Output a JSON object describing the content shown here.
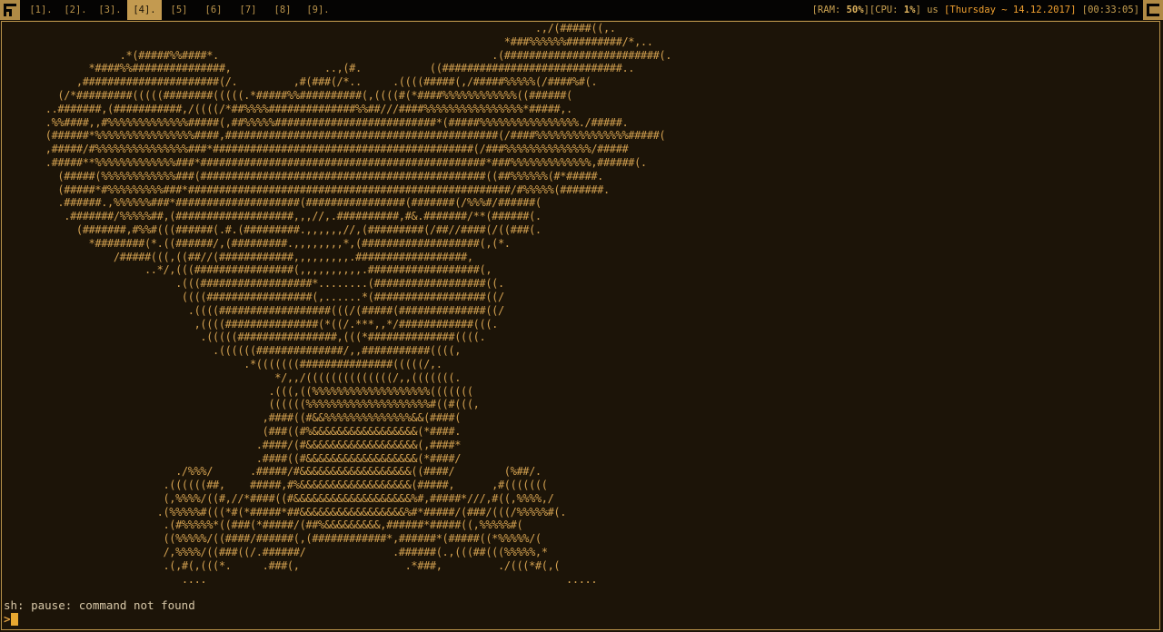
{
  "topbar": {
    "workspaces": [
      {
        "label": "[1].",
        "state": "normal"
      },
      {
        "label": "[2].",
        "state": "normal"
      },
      {
        "label": "[3].",
        "state": "normal"
      },
      {
        "label": "[4].",
        "state": "active"
      },
      {
        "label": "[5]",
        "state": "normal"
      },
      {
        "label": "[6]",
        "state": "normal"
      },
      {
        "label": "[7]",
        "state": "normal"
      },
      {
        "label": "[8]",
        "state": "normal"
      },
      {
        "label": "[9].",
        "state": "normal"
      }
    ],
    "status": {
      "ram_label": "[RAM: ",
      "ram_value": "50%",
      "cpu_label": "][CPU: ",
      "cpu_value": "1%",
      "cpu_unit": "] us ",
      "date": "[Thursday ~ 14.12.2017]",
      "time": " [00:33:05]"
    },
    "colors": {
      "accent": "#c39a50",
      "bar_bg": "#050403"
    }
  },
  "terminal": {
    "ascii_art": "                                                                                      .,/(#####((,.\n                                                                                 *###%%%%%%#########/*,..\n                   .*(#####%%####*.                                            .(#########################(.\n              *####%%###############,               ..,(#.           ((#############################..\n            ,######################(/.         ,#(###(/*..     .((((#####(,/#####%%%%%(/####%#(.\n         (/*#########(((((########(((((.*#####%%##########(,((((#(*####%%%%%%%%%%%%((######(\n       ..#######,(###########,/((((/*##%%%%##############%%##///####%%%%%%%%%%%%%%%%*#####,.\n       .%%####,,#%%%%%%%%%%%%%#####(,##%%%%%##########################*(#####%%%%%%%%%%%%%%%%./#####.\n       (######*%%%%%%%%%%%%%%%%####,############################################(/####%%%%%%%%%%%%%%%#####(\n       ,#####/#%%%%%%%%%%%%%%%###*##########################################(/###%%%%%%%%%%%%%%/#####\n       .#####**%%%%%%%%%%%%%###*##############################################*###%%%%%%%%%%%%%,######(.\n         (#####(%%%%%%%%%%%%###(##############################################((##%%%%%%(#*#####.\n         (#####*#%%%%%%%%%###*####################################################/#%%%%%(#######.\n         .######.,%%%%%%###*####################(################(#######(/%%%#/######(\n          .#######/%%%%%##,(###################,,,//,.##########,#&.#######/**(######(.\n            (#######,#%%#(((######(.#.(#########.,,,,,,//,(#########(/##//####(/((###(.\n              *########(*.((######/,(#########.,,,,,,,,*,(###################(,(*.\n                  /#####(((,((##//(############,,,,,,,,,.##################,\n                       ..*/,(((################(,,,,,,,,,,.##################(,\n                            .(((##################*........(##################((.\n                             ((((#################(,......*(##################((/\n                              .((((##################(((/(#####(##############((/\n                               ,((((###############(*((/.***,,*/############(((.\n                                .(((((################,(((*##############((((.\n                                  .((((((##############/,,###########((((,\n                                       .*(((((((###############(((((/,.\n                                            */,,/((((((((((((((/,,(((((((.\n                                           .(((,((%%%%%%%%%%%%%%%%%%%(((((((\n                                           ((((((%%%%%%%%%%%%%%%%%%%%#((#(((,\n                                          ,####((#&&%%%%%%%%%%%%%%&&(####(\n                                          (###((#%&&&&&&&&&&&&&&&&&(*####.\n                                         .####/(#&&&&&&&&&&&&&&&&&&(,####*\n                                         .####((#&&&&&&&&&&&&&&&&&&(*####/\n                            ./%%%/      .#####/#&&&&&&&&&&&&&&&&&&((####/        (%##/.\n                          .((((((##,    #####,#%&&&&&&&&&&&&&&&&&&(#####,      ,#(((((((\n                          (,%%%%/((#,//*####((#&&&&&&&&&&&&&&&&&&&%#,#####*///,#((,%%%%,/\n                         .(%%%%%#(((*#(*#####*##&&&&&&&&&&&&&&&&&%#*#####/(###/(((/%%%%%#(.\n                          .(#%%%%%*((###(*#####/(##%&&&&&&&&&,######*#####((,%%%%%#(\n                          ((%%%%%/((####/######(,(############*,######*(#####((*%%%%%/(\n                          /,%%%%/((###((/.######/              .######(.,(((##(((%%%%%,*\n                          .(,#(,(((*.     .###(,                 .*###,         ./(((*#(,(\n                             ....                                                          .....",
    "error_message": "sh: pause: command not found",
    "prompt_glyph": ">",
    "colors": {
      "art": "#d2a050",
      "background": "#1c1408",
      "cursor": "#e8a830"
    }
  }
}
